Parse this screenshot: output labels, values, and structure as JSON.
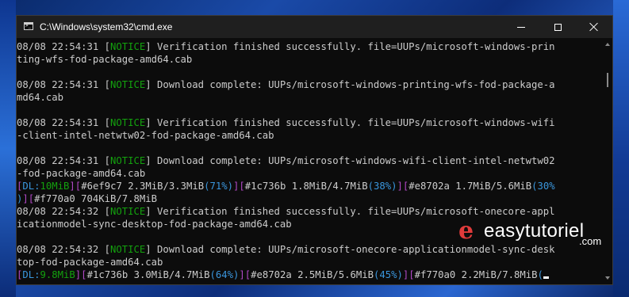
{
  "window": {
    "title": "C:\\Windows\\system32\\cmd.exe",
    "icon": "cmd-icon",
    "controls": [
      "minimize-icon",
      "maximize-icon",
      "close-icon"
    ]
  },
  "console": {
    "lines": [
      {
        "s": [
          {
            "t": "08/08 22:54:31 [",
            "k": ""
          },
          {
            "t": "NOTICE",
            "k": "g"
          },
          {
            "t": "] Verification finished successfully. file=UUPs/microsoft-windows-prin",
            "k": ""
          }
        ]
      },
      {
        "s": [
          {
            "t": "ting-wfs-fod-package-amd64.cab",
            "k": ""
          }
        ]
      },
      {
        "s": []
      },
      {
        "s": [
          {
            "t": "08/08 22:54:31 [",
            "k": ""
          },
          {
            "t": "NOTICE",
            "k": "g"
          },
          {
            "t": "] Download complete: UUPs/microsoft-windows-printing-wfs-fod-package-a",
            "k": ""
          }
        ]
      },
      {
        "s": [
          {
            "t": "md64.cab",
            "k": ""
          }
        ]
      },
      {
        "s": []
      },
      {
        "s": [
          {
            "t": "08/08 22:54:31 [",
            "k": ""
          },
          {
            "t": "NOTICE",
            "k": "g"
          },
          {
            "t": "] Verification finished successfully. file=UUPs/microsoft-windows-wifi",
            "k": ""
          }
        ]
      },
      {
        "s": [
          {
            "t": "-client-intel-netwtw02-fod-package-amd64.cab",
            "k": ""
          }
        ]
      },
      {
        "s": []
      },
      {
        "s": [
          {
            "t": "08/08 22:54:31 [",
            "k": ""
          },
          {
            "t": "NOTICE",
            "k": "g"
          },
          {
            "t": "] Download complete: UUPs/microsoft-windows-wifi-client-intel-netwtw02",
            "k": ""
          }
        ]
      },
      {
        "s": [
          {
            "t": "-fod-package-amd64.cab",
            "k": ""
          }
        ]
      },
      {
        "s": [
          {
            "t": "[",
            "k": "m"
          },
          {
            "t": "DL:",
            "k": "c"
          },
          {
            "t": "10MiB",
            "k": "g"
          },
          {
            "t": "][",
            "k": "m"
          },
          {
            "t": "#6ef9c7 2.3MiB/3.3MiB",
            "k": ""
          },
          {
            "t": "(71%)",
            "k": "c"
          },
          {
            "t": "][",
            "k": "m"
          },
          {
            "t": "#1c736b 1.8MiB/4.7MiB",
            "k": ""
          },
          {
            "t": "(38%)",
            "k": "c"
          },
          {
            "t": "][",
            "k": "m"
          },
          {
            "t": "#e8702a 1.7MiB/5.6MiB",
            "k": ""
          },
          {
            "t": "(30%",
            "k": "c"
          }
        ]
      },
      {
        "s": [
          {
            "t": ")",
            "k": "c"
          },
          {
            "t": "][",
            "k": "m"
          },
          {
            "t": "#f770a0 704KiB/7.8MiB",
            "k": ""
          }
        ]
      },
      {
        "s": [
          {
            "t": "08/08 22:54:32 [",
            "k": ""
          },
          {
            "t": "NOTICE",
            "k": "g"
          },
          {
            "t": "] Verification finished successfully. file=UUPs/microsoft-onecore-appl",
            "k": ""
          }
        ]
      },
      {
        "s": [
          {
            "t": "icationmodel-sync-desktop-fod-package-amd64.cab",
            "k": ""
          }
        ]
      },
      {
        "s": []
      },
      {
        "s": [
          {
            "t": "08/08 22:54:32 [",
            "k": ""
          },
          {
            "t": "NOTICE",
            "k": "g"
          },
          {
            "t": "] Download complete: UUPs/microsoft-onecore-applicationmodel-sync-desk",
            "k": ""
          }
        ]
      },
      {
        "s": [
          {
            "t": "top-fod-package-amd64.cab",
            "k": ""
          }
        ]
      },
      {
        "s": [
          {
            "t": "[",
            "k": "m"
          },
          {
            "t": "DL:",
            "k": "c"
          },
          {
            "t": "9.8MiB",
            "k": "g"
          },
          {
            "t": "][",
            "k": "m"
          },
          {
            "t": "#1c736b 3.0MiB/4.7MiB",
            "k": ""
          },
          {
            "t": "(64%)",
            "k": "c"
          },
          {
            "t": "][",
            "k": "m"
          },
          {
            "t": "#e8702a 2.5MiB/5.6MiB",
            "k": ""
          },
          {
            "t": "(45%)",
            "k": "c"
          },
          {
            "t": "][",
            "k": "m"
          },
          {
            "t": "#f770a0 2.2MiB/7.8MiB",
            "k": ""
          },
          {
            "t": "(",
            "k": "c"
          }
        ],
        "cursor": true
      }
    ]
  },
  "colors": {
    "notice": "#13a10e",
    "percent": "#3a96dd",
    "bracket": "#b148c6",
    "console_bg": "#0c0c0c",
    "titlebar_bg": "#1f1f1f"
  },
  "watermark": {
    "logo": "e",
    "text": "easytutoriel",
    "suffix": ".com"
  }
}
